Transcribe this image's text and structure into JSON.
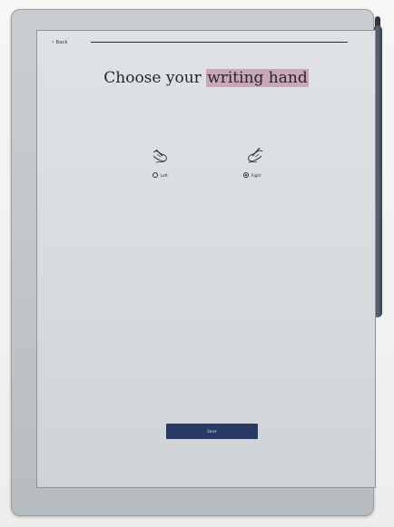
{
  "device": {
    "back_label": "Back",
    "title_prefix": "Choose your ",
    "title_highlight": "writing hand",
    "options": [
      {
        "label": "Left",
        "selected": false,
        "icon": "left-hand-writing-icon"
      },
      {
        "label": "Right",
        "selected": true,
        "icon": "right-hand-writing-icon"
      }
    ],
    "save_label": "Save"
  },
  "colors": {
    "highlight": "#c8a8b4",
    "button": "#273a66",
    "ink": "#2a2d33",
    "screen": "#dfe2e4",
    "pen": "#4a5465"
  }
}
